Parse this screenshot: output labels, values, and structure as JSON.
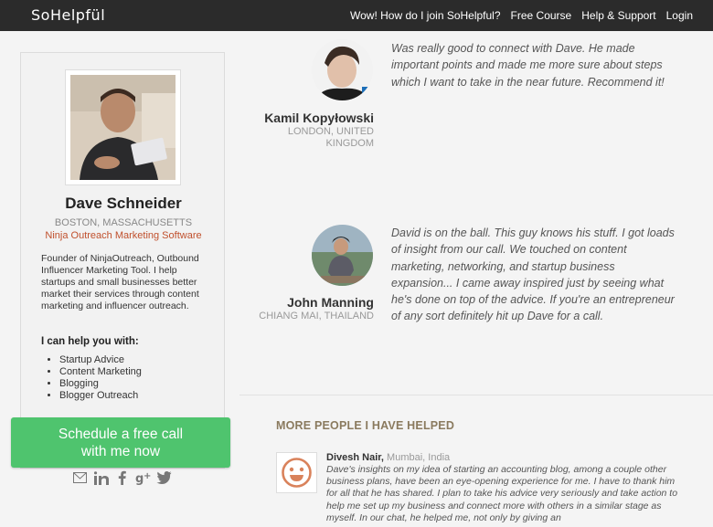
{
  "header": {
    "logo": "SoHelpfül",
    "nav": [
      {
        "label": "Wow! How do I join SoHelpful?"
      },
      {
        "label": "Free Course"
      },
      {
        "label": "Help & Support"
      },
      {
        "label": "Login"
      }
    ]
  },
  "profile": {
    "name": "Dave Schneider",
    "location": "BOSTON, MASSACHUSETTS",
    "company": "Ninja Outreach Marketing Software",
    "bio": "Founder of NinjaOutreach, Outbound Influencer Marketing Tool. I help startups and small businesses better market their services through content marketing and influencer outreach.",
    "help_title": "I can help you with:",
    "help_items": [
      "Startup Advice",
      "Content Marketing",
      "Blogging",
      "Blogger Outreach"
    ],
    "cta_line1": "Schedule a free call",
    "cta_line2": "with me now",
    "socials": [
      "email-icon",
      "linkedin-icon",
      "facebook-icon",
      "google-plus-icon",
      "twitter-icon"
    ]
  },
  "testimonials": [
    {
      "name": "Kamil Kopyłowski",
      "location": "LONDON, UNITED KINGDOM",
      "quote": "Was really good to connect with Dave. He made important points and made me more sure about steps which I want to take in the near future. Recommend it!"
    },
    {
      "name": "John Manning",
      "location": "CHIANG MAI, THAILAND",
      "quote": "David is on the ball. This guy knows his stuff. I got loads of insight from our call. We touched on content marketing, networking, and startup business expansion... I came away inspired just by seeing what he's done on top of the advice. If you're an entrepreneur of any sort definitely hit up Dave for a call."
    }
  ],
  "more_section": {
    "title": "MORE PEOPLE I HAVE HELPED",
    "items": [
      {
        "name": "Divesh Nair,",
        "city": "Mumbai, India",
        "text": "Dave's insights on my idea of starting an accounting blog, among a couple other business plans, have been an eye-opening experience for me. I have to thank him for all that he has shared. I plan to take his advice very seriously and take action to help me set up my business and connect more with others in a similar stage as myself. In our chat, he helped me, not only by giving an"
      }
    ]
  },
  "colors": {
    "topbar": "#2b2b2b",
    "cta": "#4fc46e",
    "company": "#c0502d",
    "section_title": "#8a7a5e",
    "smiley": "#d9825b"
  }
}
